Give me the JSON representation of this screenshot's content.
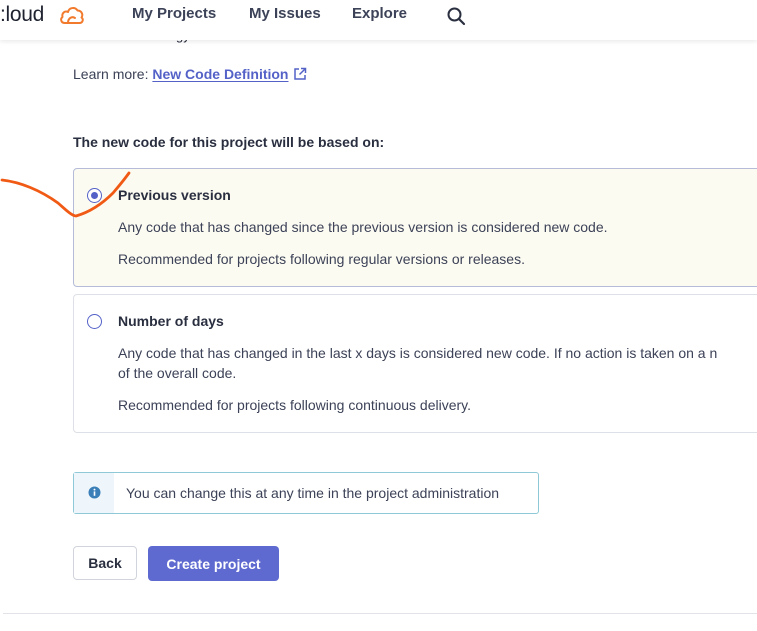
{
  "header": {
    "logo_text": ":loud",
    "nav": [
      "My Projects",
      "My Issues",
      "Explore"
    ]
  },
  "partial_text": "gy",
  "learn_more": {
    "prefix": "Learn more:",
    "link_label": "New Code Definition"
  },
  "section_title": "The new code for this project will be based on:",
  "options": [
    {
      "title": "Previous version",
      "selected": true,
      "desc1": "Any code that has changed since the previous version is considered new code.",
      "desc2": "Recommended for projects following regular versions or releases."
    },
    {
      "title": "Number of days",
      "selected": false,
      "desc1a": "Any code that has changed in the last x days is considered new code. If no action is taken on a n",
      "desc1b": "of the overall code.",
      "desc2": "Recommended for projects following continuous delivery."
    }
  ],
  "info": {
    "text": "You can change this at any time in the project administration"
  },
  "buttons": {
    "back": "Back",
    "create": "Create project"
  },
  "colors": {
    "accent": "#5f6ad0",
    "link": "#5462c8",
    "logo_orange": "#f27a2c",
    "annotation": "#f05a14",
    "info_border": "#8fc8d6",
    "selected_bg": "#fcfbf2"
  },
  "icons": {
    "logo": "cloud-icon",
    "search": "search-icon",
    "external": "external-link-icon",
    "info": "info-icon"
  }
}
